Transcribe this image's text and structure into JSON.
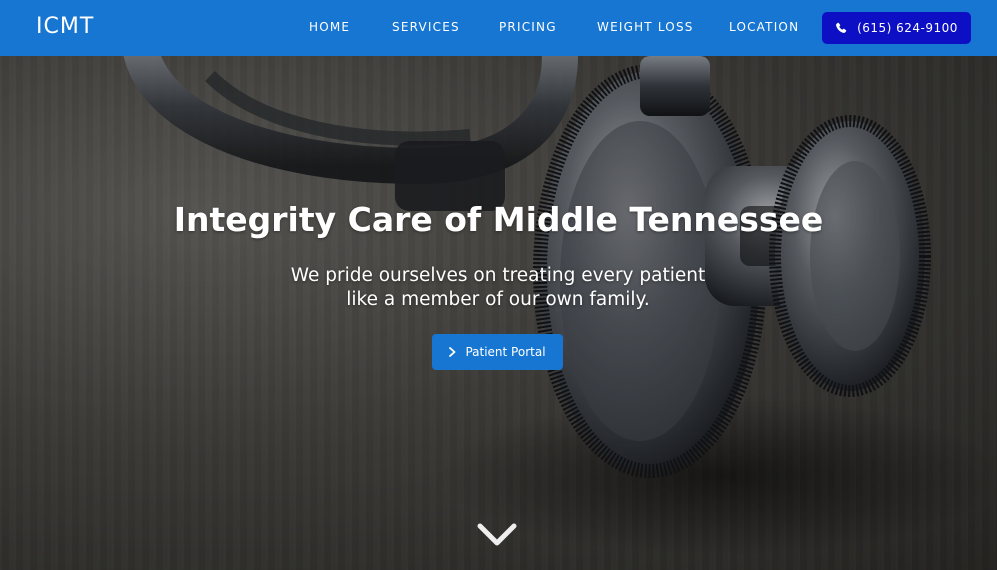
{
  "nav": {
    "logo": "ICMT",
    "links": [
      {
        "label": "HOME"
      },
      {
        "label": "SERVICES"
      },
      {
        "label": "PRICING"
      },
      {
        "label": "WEIGHT LOSS"
      },
      {
        "label": "LOCATION"
      }
    ],
    "phone": {
      "label": "(615) 624-9100",
      "icon": "phone-icon"
    }
  },
  "hero": {
    "title": "Integrity Care of Middle Tennessee",
    "subtitle_line1": "We pride ourselves on treating every patient",
    "subtitle_line2": "like a member of our own family.",
    "button": {
      "label": "Patient Portal",
      "icon": "chevron-right-icon"
    },
    "scroll_icon": "chevron-down-icon"
  },
  "colors": {
    "nav_bg": "#1776d2",
    "phone_btn_bg": "#0c0fc4",
    "portal_btn_bg": "#1776d2",
    "text": "#ffffff"
  }
}
